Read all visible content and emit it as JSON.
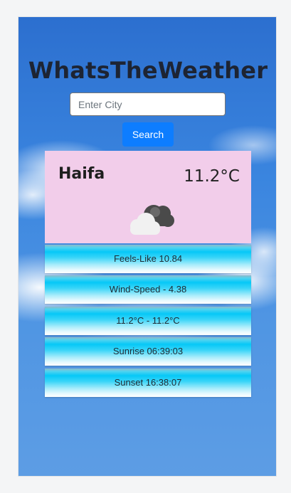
{
  "app": {
    "title": "WhatsTheWeather"
  },
  "search": {
    "placeholder": "Enter City",
    "value": "",
    "button_label": "Search"
  },
  "weather": {
    "city": "Haifa",
    "temperature": "11.2°C",
    "icon": "cloudy-icon",
    "stats": [
      {
        "label": "Feels-Like 10.84"
      },
      {
        "label": "Wind-Speed - 4.38"
      },
      {
        "label": "11.2°C - 11.2°C"
      },
      {
        "label": "Sunrise 06:39:03"
      },
      {
        "label": "Sunset 16:38:07"
      }
    ]
  },
  "colors": {
    "accent": "#0d7dff",
    "card_background": "#f2cdea",
    "stat_bar": "#06c8f7"
  }
}
